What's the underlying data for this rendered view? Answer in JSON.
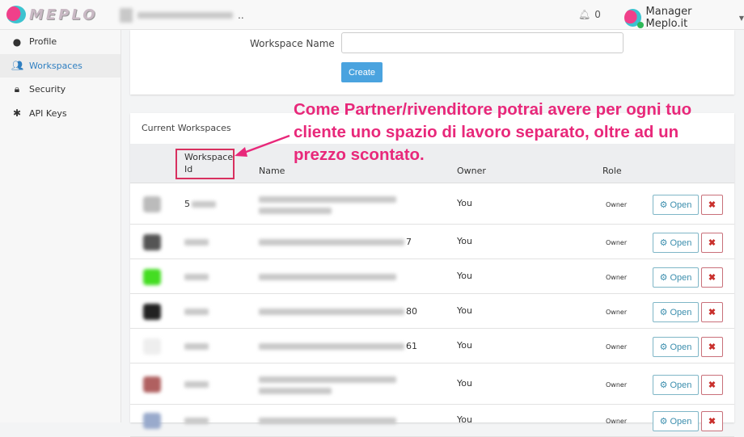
{
  "header": {
    "logo": "MEPLO",
    "breadcrumb_suffix": "..",
    "notifications": "0",
    "user": "Manager Meplo.it"
  },
  "sidebar": {
    "items": [
      {
        "label": "Profile",
        "icon": "user-circle-icon"
      },
      {
        "label": "Workspaces",
        "icon": "users-icon",
        "active": true
      },
      {
        "label": "Security",
        "icon": "lock-icon"
      },
      {
        "label": "API Keys",
        "icon": "puzzle-icon"
      }
    ]
  },
  "create_form": {
    "label": "Workspace Name",
    "value": "",
    "button": "Create"
  },
  "workspaces": {
    "title": "Current Workspaces",
    "columns": {
      "id": "Workspace Id",
      "name": "Name",
      "owner": "Owner",
      "role": "Role"
    },
    "open_label": "Open",
    "delete_label": "✖",
    "rows": [
      {
        "id": "5",
        "name_tail": "",
        "owner": "You",
        "role": "Owner",
        "color": "#bbb"
      },
      {
        "id": "",
        "name_tail": "7",
        "owner": "You",
        "role": "Owner",
        "color": "#555"
      },
      {
        "id": "",
        "name_tail": "",
        "owner": "You",
        "role": "Owner",
        "color": "#44dd22"
      },
      {
        "id": "",
        "name_tail": "80",
        "owner": "You",
        "role": "Owner",
        "color": "#222"
      },
      {
        "id": "",
        "name_tail": "61",
        "owner": "You",
        "role": "Owner",
        "color": "#eee"
      },
      {
        "id": "",
        "name_tail": "",
        "owner": "You",
        "role": "Owner",
        "color": "#b06060"
      },
      {
        "id": "",
        "name_tail": "",
        "owner": "You",
        "role": "Owner",
        "color": "#99aacc"
      }
    ]
  },
  "annotation": "Come Partner/rivenditore potrai avere per ogni tuo cliente uno spazio di lavoro separato, oltre ad un prezzo scontato."
}
